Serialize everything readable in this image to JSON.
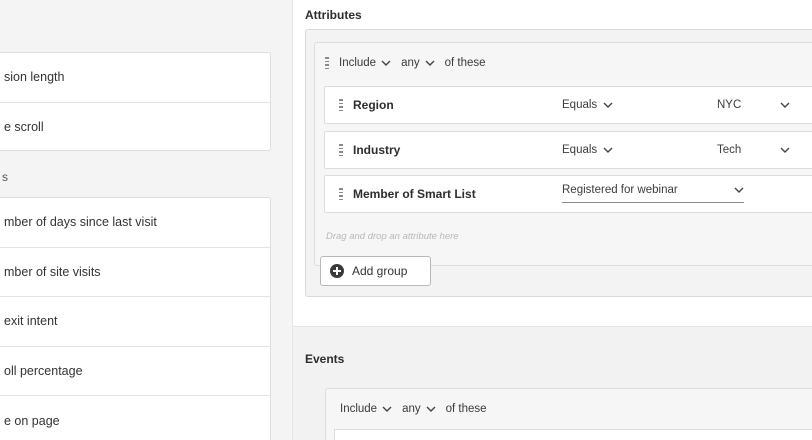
{
  "sidebar": {
    "group1": [
      {
        "label": "sion length"
      },
      {
        "label": "e scroll"
      }
    ],
    "partial_header": "s",
    "group2": [
      {
        "label": "mber of days since last visit"
      },
      {
        "label": "mber of site visits"
      },
      {
        "label": "exit intent"
      },
      {
        "label": "oll percentage"
      },
      {
        "label": "e on page"
      }
    ]
  },
  "attributes": {
    "title": "Attributes",
    "logic": {
      "include": "Include",
      "quantifier": "any",
      "suffix": "of these"
    },
    "conditions": [
      {
        "name": "Region",
        "operator": "Equals",
        "value": "NYC"
      },
      {
        "name": "Industry",
        "operator": "Equals",
        "value": "Tech"
      },
      {
        "name": "Member of Smart List",
        "value": "Registered for webinar"
      }
    ],
    "drop_hint": "Drag and drop an attribute here",
    "add_group_label": "Add group"
  },
  "events": {
    "title": "Events",
    "logic": {
      "include": "Include",
      "quantifier": "any",
      "suffix": "of these"
    }
  },
  "icons": {
    "drag": "drag-handle-icon",
    "chevron": "chevron-down-icon",
    "add": "plus-circle-icon"
  }
}
